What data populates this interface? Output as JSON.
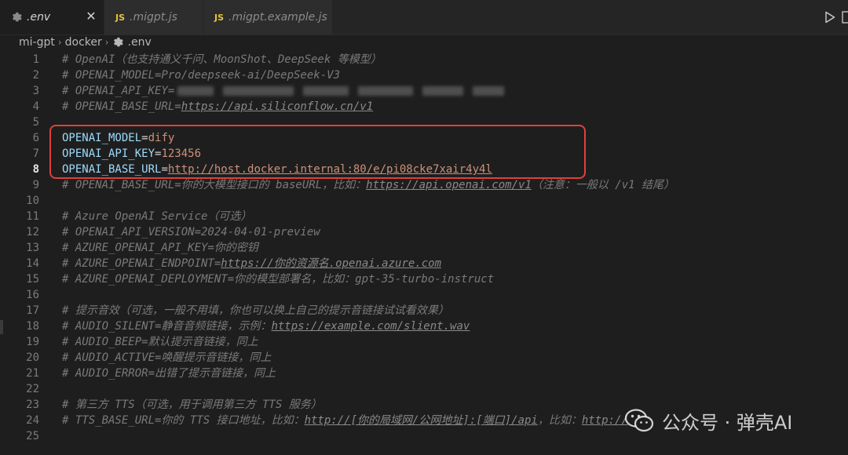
{
  "tabs": [
    {
      "label": ".env",
      "icon": "gear-icon",
      "active": true
    },
    {
      "label": ".migpt.js",
      "icon": "js-file-icon",
      "badge": "JS",
      "active": false
    },
    {
      "label": ".migpt.example.js",
      "icon": "js-file-icon",
      "badge": "JS",
      "active": false
    }
  ],
  "breadcrumb": [
    "mi-gpt",
    "docker",
    ".env"
  ],
  "lines": [
    {
      "n": "1",
      "text": "# OpenAI（也支持通义千问、MoonShot、DeepSeek 等模型）"
    },
    {
      "n": "2",
      "text": "# OPENAI_MODEL=Pro/deepseek-ai/DeepSeek-V3"
    },
    {
      "n": "3",
      "text": "# OPENAI_API_KEY="
    },
    {
      "n": "4",
      "text": "# OPENAI_BASE_URL=",
      "url": "https://api.siliconflow.cn/v1"
    },
    {
      "n": "5",
      "text": ""
    },
    {
      "n": "6",
      "key": "OPENAI_MODEL",
      "value": "dify"
    },
    {
      "n": "7",
      "key": "OPENAI_API_KEY",
      "value": "123456"
    },
    {
      "n": "8",
      "key": "OPENAI_BASE_URL",
      "value": "http://host.docker.internal:80/e/pi08cke7xair4y4l"
    },
    {
      "n": "9",
      "text": "# OPENAI_BASE_URL=你的大模型接口的 baseURL，比如：",
      "url": "https://api.openai.com/v1",
      "tail": "（注意：一般以 /v1 结尾）"
    },
    {
      "n": "10",
      "text": ""
    },
    {
      "n": "11",
      "text": "# Azure OpenAI Service（可选）"
    },
    {
      "n": "12",
      "text": "# OPENAI_API_VERSION=2024-04-01-preview"
    },
    {
      "n": "13",
      "text": "# AZURE_OPENAI_API_KEY=你的密钥"
    },
    {
      "n": "14",
      "text": "# AZURE_OPENAI_ENDPOINT=",
      "url": "https://你的资源名.openai.azure.com"
    },
    {
      "n": "15",
      "text": "# AZURE_OPENAI_DEPLOYMENT=你的模型部署名，比如：gpt-35-turbo-instruct"
    },
    {
      "n": "16",
      "text": ""
    },
    {
      "n": "17",
      "text": "# 提示音效（可选，一般不用填，你也可以换上自己的提示音链接试试看效果）"
    },
    {
      "n": "18",
      "text": "# AUDIO_SILENT=静音音频链接，示例：",
      "url": "https://example.com/slient.wav"
    },
    {
      "n": "19",
      "text": "# AUDIO_BEEP=默认提示音链接，同上"
    },
    {
      "n": "20",
      "text": "# AUDIO_ACTIVE=唤醒提示音链接，同上"
    },
    {
      "n": "21",
      "text": "# AUDIO_ERROR=出错了提示音链接，同上"
    },
    {
      "n": "22",
      "text": ""
    },
    {
      "n": "23",
      "text": "# 第三方 TTS（可选，用于调用第三方 TTS 服务）"
    },
    {
      "n": "24",
      "text": "# TTS_BASE_URL=你的 TTS 接口地址，比如：",
      "url": "http://[你的局域网/公网地址]:[端口]/api",
      "tail": "，比如：",
      "url2": "http://"
    },
    {
      "n": "25",
      "text": ""
    }
  ],
  "current_line": "8",
  "watermark": {
    "text": "公众号 · 弹壳AI"
  },
  "colors": {
    "highlight_border": "#e0403a",
    "js_badge": "#e8c33a"
  }
}
